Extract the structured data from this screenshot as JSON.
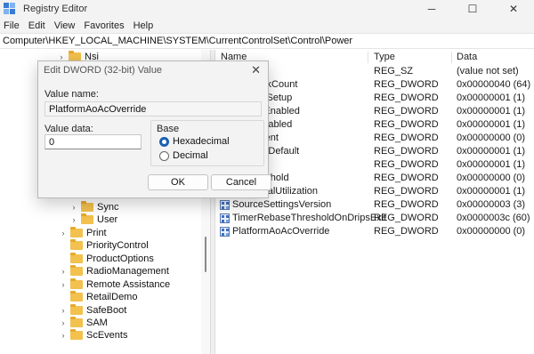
{
  "window": {
    "title": "Registry Editor",
    "minimize": "─",
    "maximize": "☐",
    "close": "✕"
  },
  "menu": [
    "File",
    "Edit",
    "View",
    "Favorites",
    "Help"
  ],
  "address": "Computer\\HKEY_LOCAL_MACHINE\\SYSTEM\\CurrentControlSet\\Control\\Power",
  "tree": {
    "items": [
      {
        "label": "Nsi",
        "expander": "›"
      },
      {
        "label": "Sync",
        "expander": "›"
      },
      {
        "label": "User",
        "expander": "›"
      },
      {
        "label": "Print",
        "expander": "›"
      },
      {
        "label": "PriorityControl",
        "expander": ""
      },
      {
        "label": "ProductOptions",
        "expander": ""
      },
      {
        "label": "RadioManagement",
        "expander": "›"
      },
      {
        "label": "Remote Assistance",
        "expander": "›"
      },
      {
        "label": "RetailDemo",
        "expander": ""
      },
      {
        "label": "SafeBoot",
        "expander": "›"
      },
      {
        "label": "SAM",
        "expander": "›"
      },
      {
        "label": "ScEvents",
        "expander": "›"
      }
    ]
  },
  "list": {
    "headers": {
      "name": "Name",
      "type": "Type",
      "data": "Data"
    },
    "rows": [
      {
        "name": "",
        "type": "REG_SZ",
        "data": "(value not set)"
      },
      {
        "name": "alUnparkCount",
        "type": "REG_DWORD",
        "data": "0x00000040 (64)"
      },
      {
        "name": "eDuringSetup",
        "type": "REG_DWORD",
        "data": "0x00000001 (1)"
      },
      {
        "name": "imationEnabled",
        "type": "REG_DWORD",
        "data": "0x00000001 (1)"
      },
      {
        "name": "essorEnabled",
        "type": "REG_DWORD",
        "data": "0x00000001 (1)"
      },
      {
        "name": "izePercent",
        "type": "REG_DWORD",
        "data": "0x00000000 (0)"
      },
      {
        "name": "EnabledDefault",
        "type": "REG_DWORD",
        "data": "0x00000001 (1)"
      },
      {
        "name": "lityState",
        "type": "REG_DWORD",
        "data": "0x00000001 (1)"
      },
      {
        "name": "ingThreshold",
        "type": "REG_DWORD",
        "data": "0x00000000 (0)"
      },
      {
        "name": "lateActualUtilization",
        "type": "REG_DWORD",
        "data": "0x00000001 (1)"
      },
      {
        "name": "SourceSettingsVersion",
        "type": "REG_DWORD",
        "data": "0x00000003 (3)"
      },
      {
        "name": "TimerRebaseThresholdOnDripsExit",
        "type": "REG_DWORD",
        "data": "0x0000003c (60)"
      },
      {
        "name": "PlatformAoAcOverride",
        "type": "REG_DWORD",
        "data": "0x00000000 (0)"
      }
    ]
  },
  "dialog": {
    "title": "Edit DWORD (32-bit) Value",
    "close": "✕",
    "value_name_label": "Value name:",
    "value_name": "PlatformAoAcOverride",
    "value_data_label": "Value data:",
    "value_data": "0",
    "base_label": "Base",
    "hex_label": "Hexadecimal",
    "dec_label": "Decimal",
    "ok": "OK",
    "cancel": "Cancel"
  }
}
